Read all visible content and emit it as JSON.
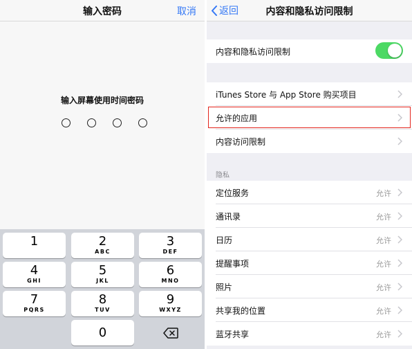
{
  "passcode_screen": {
    "title": "输入密码",
    "cancel_label": "取消",
    "prompt": "输入屏幕使用时间密码",
    "keys": [
      {
        "digit": "1",
        "letters": ""
      },
      {
        "digit": "2",
        "letters": "ABC"
      },
      {
        "digit": "3",
        "letters": "DEF"
      },
      {
        "digit": "4",
        "letters": "GHI"
      },
      {
        "digit": "5",
        "letters": "JKL"
      },
      {
        "digit": "6",
        "letters": "MNO"
      },
      {
        "digit": "7",
        "letters": "PQRS"
      },
      {
        "digit": "8",
        "letters": "TUV"
      },
      {
        "digit": "9",
        "letters": "WXYZ"
      },
      {
        "digit": "0",
        "letters": ""
      }
    ],
    "delete_icon": "backspace-icon"
  },
  "restrictions_screen": {
    "back_label": "返回",
    "title": "内容和隐私访问限制",
    "toggle_row": {
      "label": "内容和隐私访问限制",
      "enabled": true
    },
    "store_rows": [
      {
        "label": "iTunes Store 与 App Store 购买项目"
      },
      {
        "label": "允许的应用"
      },
      {
        "label": "内容访问限制"
      }
    ],
    "privacy_header": "隐私",
    "privacy_rows": [
      {
        "label": "定位服务",
        "value": "允许"
      },
      {
        "label": "通讯录",
        "value": "允许"
      },
      {
        "label": "日历",
        "value": "允许"
      },
      {
        "label": "提醒事项",
        "value": "允许"
      },
      {
        "label": "照片",
        "value": "允许"
      },
      {
        "label": "共享我的位置",
        "value": "允许"
      },
      {
        "label": "蓝牙共享",
        "value": "允许"
      }
    ]
  },
  "colors": {
    "accent": "#3478f6",
    "toggle_on": "#4cd964",
    "highlight_border": "#e3241c",
    "group_background": "#efeff4"
  }
}
